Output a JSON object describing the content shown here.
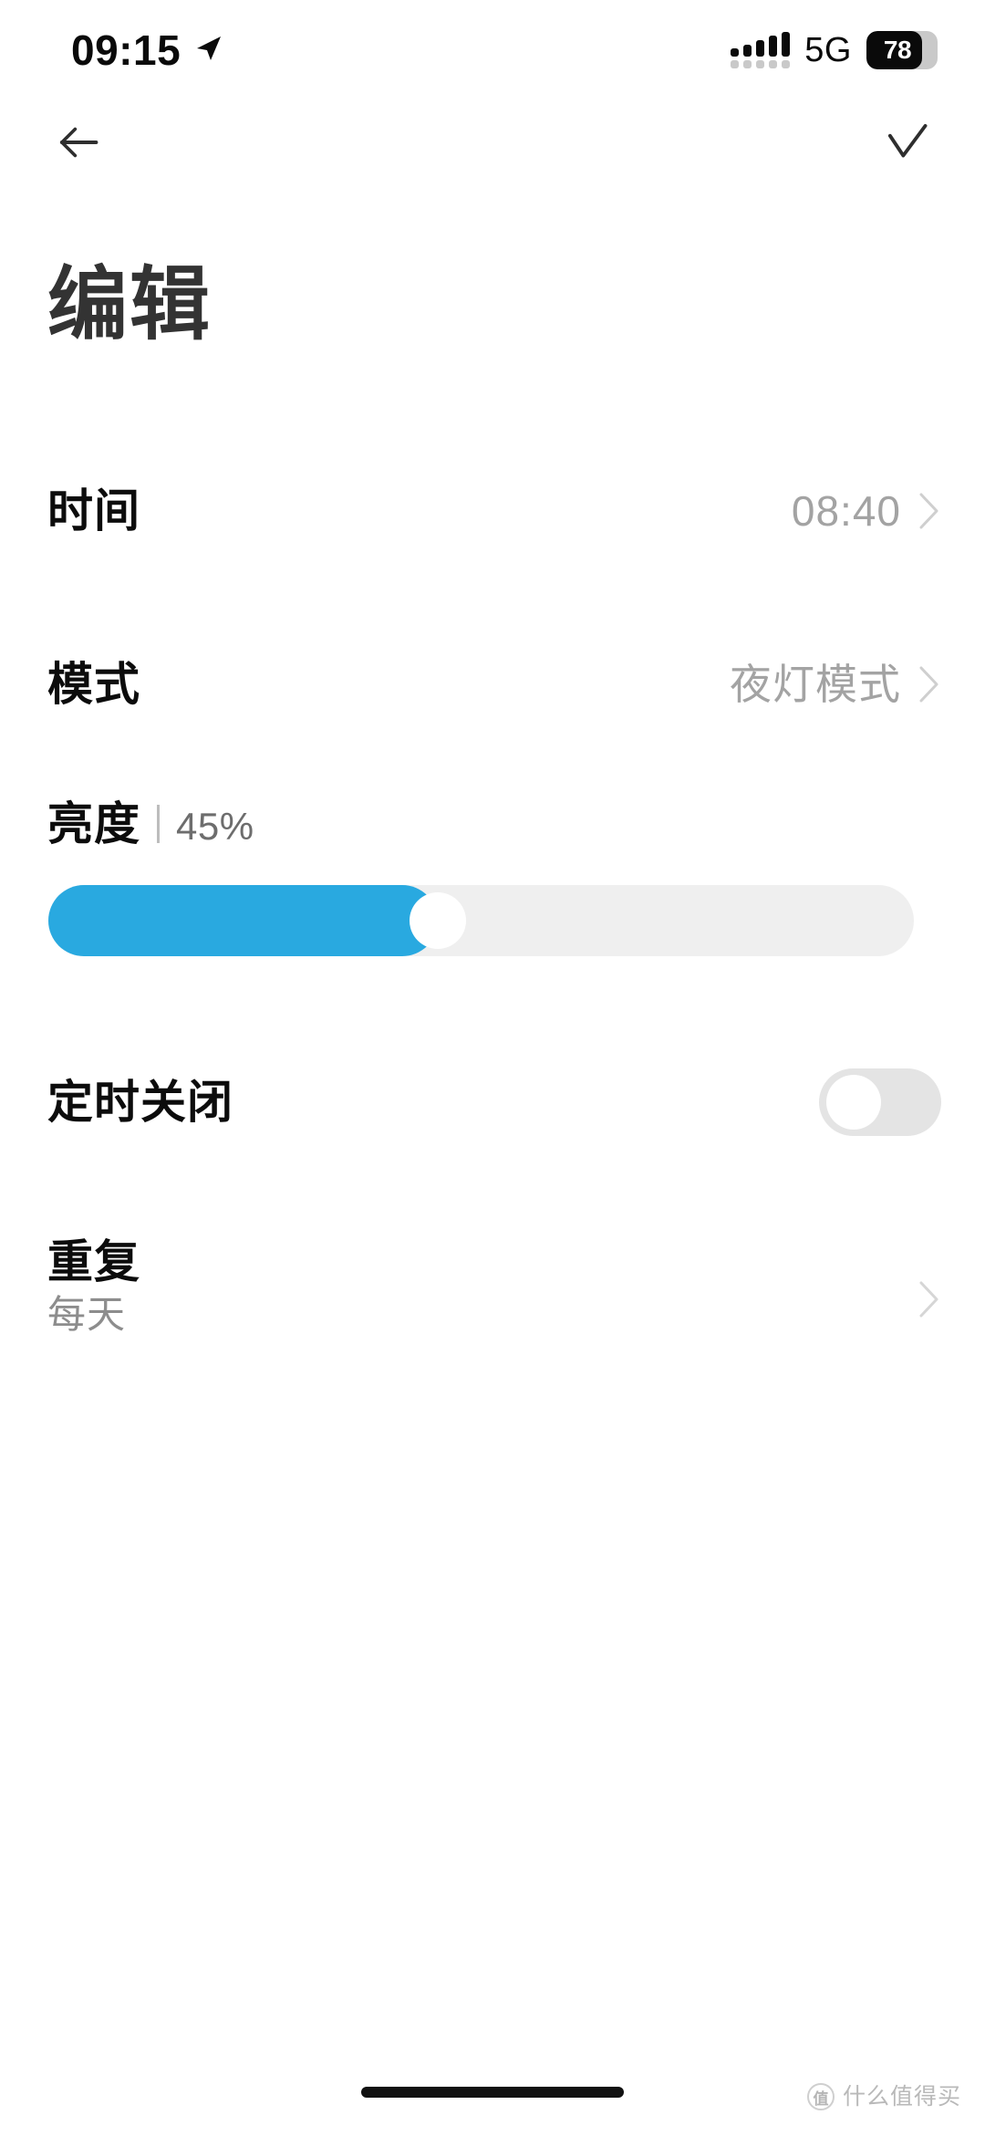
{
  "status_bar": {
    "time": "09:15",
    "location_icon": "location-arrow-icon",
    "signal_icon": "signal-bars-icon",
    "network": "5G",
    "battery_level": "78",
    "battery_percent": 78
  },
  "nav": {
    "back_icon": "arrow-left-icon",
    "done_icon": "checkmark-icon"
  },
  "header": {
    "title": "编辑"
  },
  "rows": {
    "time": {
      "label": "时间",
      "value": "08:40",
      "chevron_icon": "chevron-right-icon"
    },
    "mode": {
      "label": "模式",
      "value": "夜灯模式",
      "chevron_icon": "chevron-right-icon"
    },
    "brightness": {
      "label": "亮度",
      "value": "45%",
      "percent": 45
    },
    "timer_off": {
      "label": "定时关闭",
      "toggle_state": "off"
    },
    "repeat": {
      "label": "重复",
      "subtitle": "每天",
      "chevron_icon": "chevron-right-icon"
    }
  },
  "watermark": {
    "text": "什么值得买",
    "logo": "zhi-logo-icon"
  },
  "colors": {
    "accent": "#29a9e0",
    "track": "#efefef",
    "toggle_off": "#e4e4e4",
    "label": "#0c0c0c",
    "value": "#a3a3a3",
    "title": "#333333"
  }
}
